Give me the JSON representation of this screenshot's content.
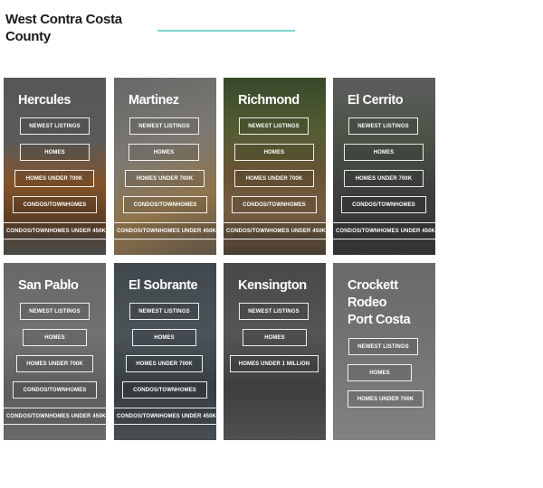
{
  "page": {
    "title": "West Contra Costa County",
    "accent_color": "#7fd6cf"
  },
  "cards": [
    {
      "name": [
        "Hercules"
      ],
      "buttons": [
        "NEWEST LISTINGS",
        "HOMES",
        "HOMES UNDER 700K",
        "CONDOS/TOWNHOMES"
      ],
      "wide_button": "CONDOS/TOWNHOMES UNDER 450K"
    },
    {
      "name": [
        "Martinez"
      ],
      "buttons": [
        "NEWEST LISTINGS",
        "HOMES",
        "HOMES UNDER 700K",
        "CONDOS/TOWNHOMES"
      ],
      "wide_button": "CONDOS/TOWNHOMES UNDER 450K"
    },
    {
      "name": [
        "Richmond"
      ],
      "buttons": [
        "NEWEST LISTINGS",
        "HOMES",
        "HOMES UNDER 700K",
        "CONDOS/TOWNHOMES"
      ],
      "wide_button": "CONDOS/TOWNHOMES UNDER 450K"
    },
    {
      "name": [
        "El Cerrito"
      ],
      "buttons": [
        "NEWEST LISTINGS",
        "HOMES",
        "HOMES UNDER 700K",
        "CONDOS/TOWNHOMES"
      ],
      "wide_button": "CONDOS/TOWNHOMES UNDER 450K"
    },
    {
      "name": [
        "San Pablo"
      ],
      "buttons": [
        "NEWEST LISTINGS",
        "HOMES",
        "HOMES UNDER 700K",
        "CONDOS/TOWNHOMES"
      ],
      "wide_button": "CONDOS/TOWNHOMES UNDER 450K"
    },
    {
      "name": [
        "El Sobrante"
      ],
      "buttons": [
        "NEWEST LISTINGS",
        "HOMES",
        "HOMES UNDER 700K",
        "CONDOS/TOWNHOMES"
      ],
      "wide_button": "CONDOS/TOWNHOMES  UNDER 450K"
    },
    {
      "name": [
        "Kensington"
      ],
      "buttons": [
        "NEWEST LISTINGS",
        "HOMES",
        "HOMES UNDER 1 MILLION"
      ],
      "wide_button": ""
    },
    {
      "name": [
        "Crockett",
        "Rodeo",
        "Port Costa"
      ],
      "buttons": [
        "NEWEST LISTINGS",
        "HOMES",
        "HOMES UNDER 700K"
      ],
      "wide_button": ""
    }
  ]
}
